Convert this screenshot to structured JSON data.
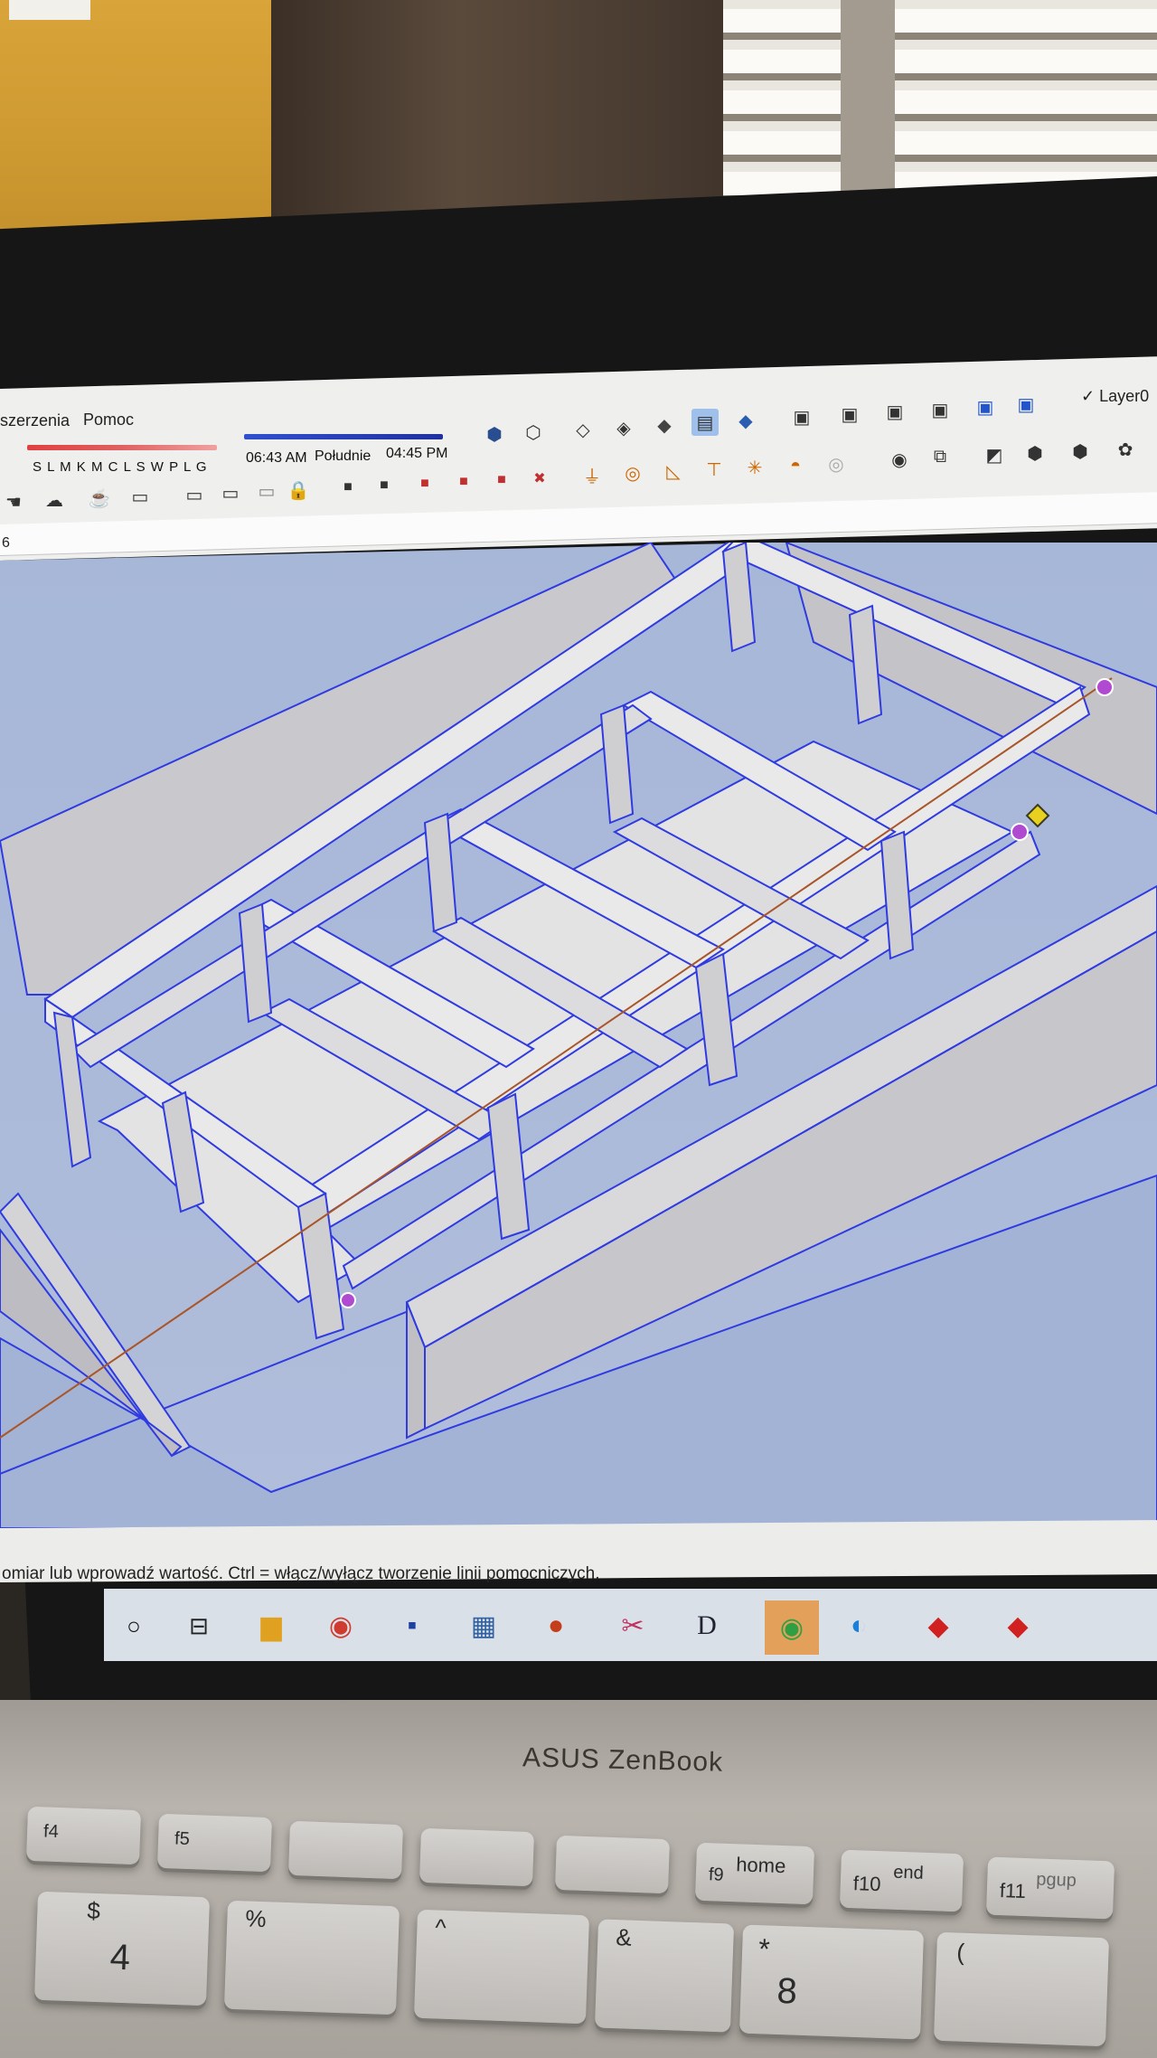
{
  "menu": {
    "item_extensions": "szerzenia",
    "item_help": "Pomoc"
  },
  "shadows": {
    "month_letters": "S L M K M C L S W P L G",
    "sunrise": "06:43 AM",
    "noon": "Południe",
    "sunset": "04:45 PM"
  },
  "layers": {
    "label": "Layer0",
    "check": "✓"
  },
  "measurements": {
    "value": "6"
  },
  "status": {
    "hint": "omiar lub wprowadź wartość. Ctrl = włącz/wyłącz tworzenie linii pomocniczych."
  },
  "taskbar": {
    "icons": [
      "circle-icon",
      "task-view-icon",
      "folder-icon",
      "chrome-icon",
      "save-icon",
      "calculator-icon",
      "powerpoint-icon",
      "snip-icon",
      "dictionary-icon",
      "whatsapp-icon",
      "edge-icon",
      "sketchup-icon",
      "sketchup-icon-2"
    ]
  },
  "laptop": {
    "brand": "ASUS ZenBook"
  },
  "keyboard": {
    "f4": "f4",
    "f5": "f5",
    "f9": "f9",
    "home": "home",
    "f10": "f10",
    "end": "end",
    "f11": "f11",
    "pgup": "pgup",
    "dollar": "$",
    "four": "4",
    "percent": "%",
    "caret": "^",
    "amp": "&",
    "star": "*",
    "eight": "8",
    "paren": "("
  },
  "colors": {
    "axis_blue": "#2f3be0",
    "viewport_bg": "#aebcda",
    "inference_purple": "#b04ad0",
    "inference_yellow": "#e8d020"
  }
}
